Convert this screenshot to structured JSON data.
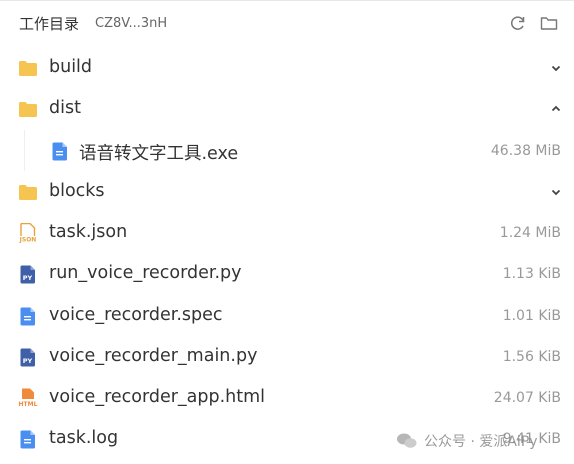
{
  "header": {
    "title": "工作目录",
    "subtitle": "CZ8V...3nH",
    "icons": [
      "refresh-icon",
      "folder-open-icon"
    ]
  },
  "files": [
    {
      "name": "build",
      "type": "folder",
      "size": "",
      "chevron": "down"
    },
    {
      "name": "dist",
      "type": "folder",
      "size": "",
      "chevron": "up"
    },
    {
      "name": "语音转文字工具.exe",
      "type": "file",
      "size": "46.38 MiB",
      "chevron": ""
    },
    {
      "name": "blocks",
      "type": "folder",
      "size": "",
      "chevron": "down"
    },
    {
      "name": "task.json",
      "type": "json",
      "size": "1.24 MiB",
      "chevron": ""
    },
    {
      "name": "run_voice_recorder.py",
      "type": "py",
      "size": "1.13 KiB",
      "chevron": ""
    },
    {
      "name": "voice_recorder.spec",
      "type": "file",
      "size": "1.01 KiB",
      "chevron": ""
    },
    {
      "name": "voice_recorder_main.py",
      "type": "py",
      "size": "1.56 KiB",
      "chevron": ""
    },
    {
      "name": "voice_recorder_app.html",
      "type": "html",
      "size": "24.07 KiB",
      "chevron": ""
    },
    {
      "name": "task.log",
      "type": "file",
      "size": "9.41 KiB",
      "chevron": ""
    }
  ],
  "watermark": {
    "text": "公众号 · 爱派AiPy"
  },
  "colors": {
    "folder": "#f5c451",
    "file_blue": "#4a8ef0",
    "json": "#e6a23c",
    "py": "#3f5fa8",
    "html": "#f08a3c",
    "text": "#333333",
    "muted": "#999999"
  }
}
